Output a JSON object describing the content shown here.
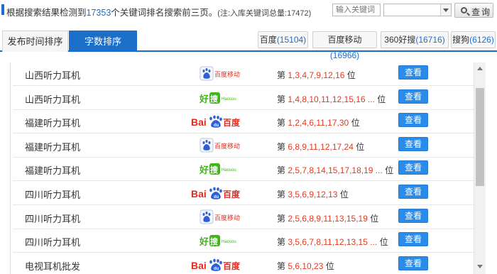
{
  "header": {
    "summary_prefix": "根据搜索结果检测到",
    "keyword_total": "17353",
    "summary_suffix": "个关键词排名搜索前三页。",
    "note": "(注:入库关键词总量:17472)",
    "input_placeholder": "输入关键词",
    "select_value": "",
    "search_label": "查询"
  },
  "tabs": [
    {
      "label": "发布时间排序",
      "active": false
    },
    {
      "label": "字数排序",
      "active": true
    }
  ],
  "engine_tabs": [
    {
      "name": "百度",
      "count": "(15104)"
    },
    {
      "name": "百度移动",
      "count": "(16966)"
    },
    {
      "name": "360好搜",
      "count": "(16716)"
    },
    {
      "name": "搜狗",
      "count": "(6126)"
    }
  ],
  "rank_prefix": "第",
  "rank_suffix": "位",
  "view_label": "查看",
  "rows": [
    {
      "keyword": "山西听力耳机",
      "engine": "baidu-mobile",
      "ranks": "1,3,4,7,9,12,16"
    },
    {
      "keyword": "山西听力耳机",
      "engine": "haosou",
      "ranks": "1,4,8,10,11,12,15,16 ..."
    },
    {
      "keyword": "福建听力耳机",
      "engine": "baidu",
      "ranks": "1,2,4,6,11,17,30"
    },
    {
      "keyword": "福建听力耳机",
      "engine": "baidu-mobile",
      "ranks": "6,8,9,11,12,17,24"
    },
    {
      "keyword": "福建听力耳机",
      "engine": "haosou",
      "ranks": "2,5,7,8,14,15,17,18,19 ..."
    },
    {
      "keyword": "四川听力耳机",
      "engine": "baidu",
      "ranks": "3,5,6,9,12,13"
    },
    {
      "keyword": "四川听力耳机",
      "engine": "baidu-mobile",
      "ranks": "2,5,6,8,9,11,13,15,19"
    },
    {
      "keyword": "四川听力耳机",
      "engine": "haosou",
      "ranks": "3,5,6,7,8,11,12,13,15 ..."
    },
    {
      "keyword": "电视耳机批发",
      "engine": "baidu",
      "ranks": "5,6,10,23"
    }
  ],
  "logos": {
    "baidu": {
      "t1": "Bai",
      "t2": "百度"
    },
    "baidu-mobile": {
      "t1": "百度移动"
    },
    "haosou": {
      "t1": "好",
      "t2": "搜",
      "t3": "Haosou"
    }
  },
  "colors": {
    "accent": "#1b6fc9",
    "rank_red": "#e03a1e",
    "button_blue": "#2b8be8"
  }
}
